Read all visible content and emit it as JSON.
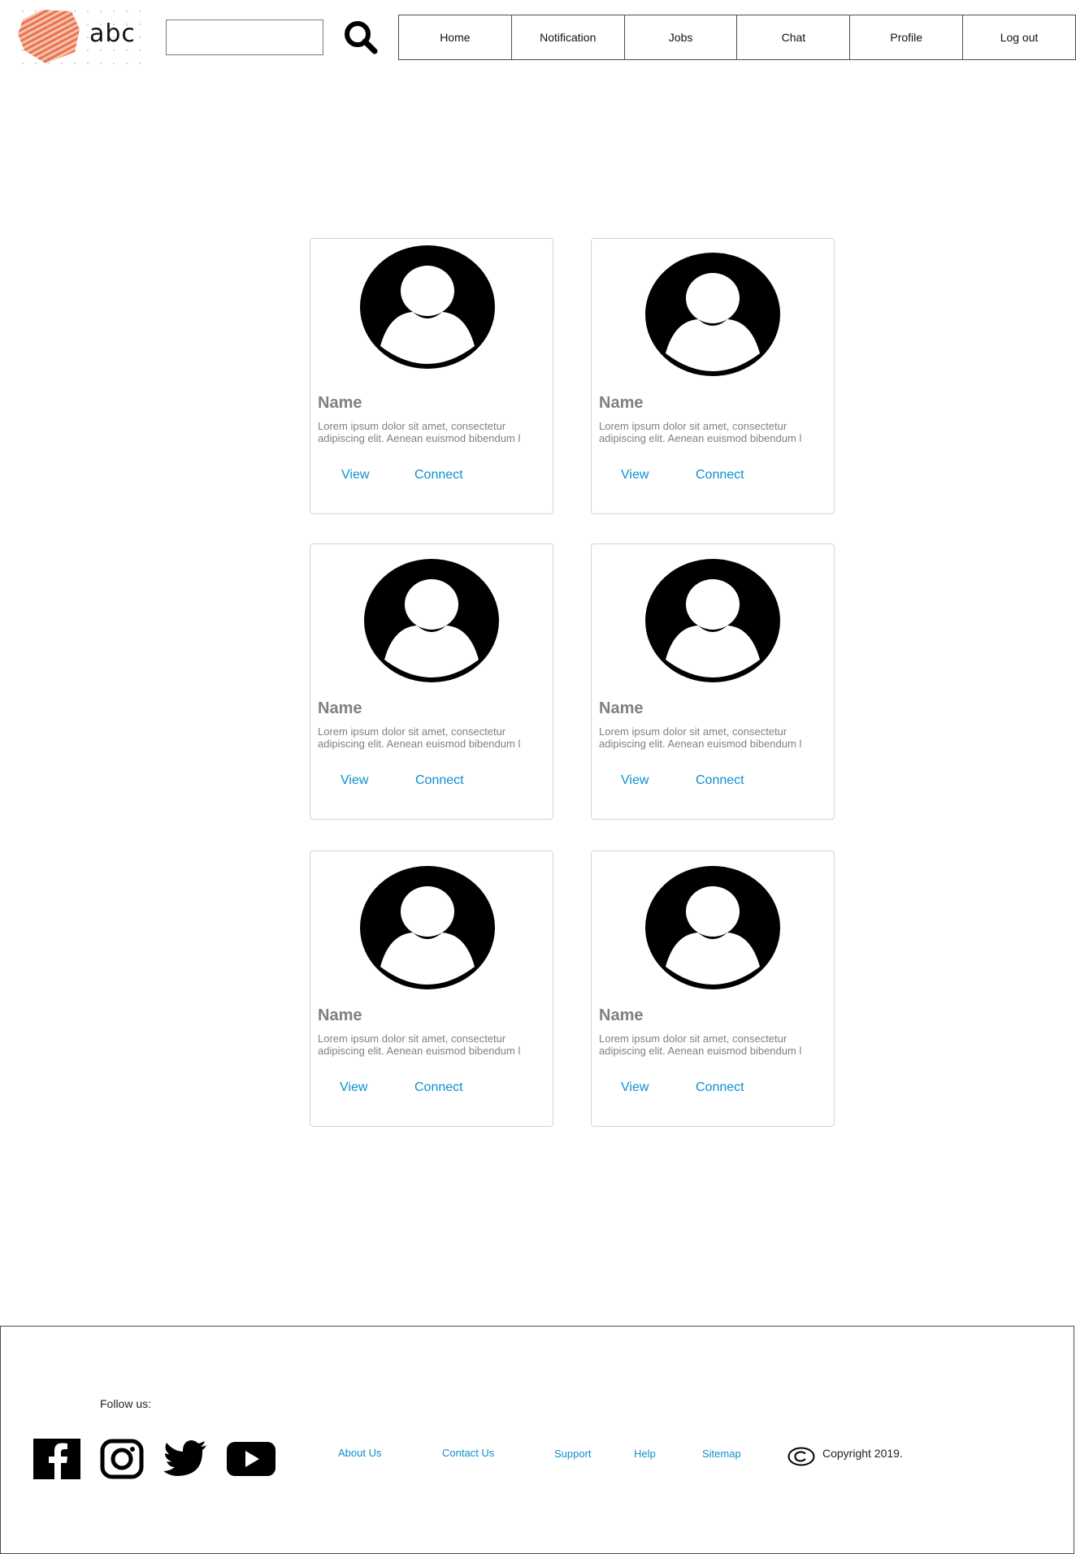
{
  "header": {
    "logo_text": "abc",
    "brand_color": "#e8744f",
    "search": {
      "value": "",
      "placeholder": ""
    },
    "search_icon": "search-icon",
    "nav": [
      {
        "id": "home",
        "label": "Home"
      },
      {
        "id": "notification",
        "label": "Notification"
      },
      {
        "id": "jobs",
        "label": "Jobs"
      },
      {
        "id": "chat",
        "label": "Chat"
      },
      {
        "id": "profile",
        "label": "Profile"
      },
      {
        "id": "logout",
        "label": "Log out"
      }
    ]
  },
  "cards": [
    {
      "name": "Name",
      "description": "Lorem ipsum dolor sit amet, consectetur adipiscing elit. Aenean euismod bibendum l",
      "view_label": "View",
      "connect_label": "Connect",
      "avatar_icon": "user-avatar-icon"
    },
    {
      "name": "Name",
      "description": "Lorem ipsum dolor sit amet, consectetur adipiscing elit. Aenean euismod bibendum l",
      "view_label": "View",
      "connect_label": "Connect",
      "avatar_icon": "user-avatar-icon"
    },
    {
      "name": "Name",
      "description": "Lorem ipsum dolor sit amet, consectetur adipiscing elit. Aenean euismod bibendum l",
      "view_label": "View",
      "connect_label": "Connect",
      "avatar_icon": "user-avatar-icon"
    },
    {
      "name": "Name",
      "description": "Lorem ipsum dolor sit amet, consectetur adipiscing elit. Aenean euismod bibendum l",
      "view_label": "View",
      "connect_label": "Connect",
      "avatar_icon": "user-avatar-icon"
    },
    {
      "name": "Name",
      "description": "Lorem ipsum dolor sit amet, consectetur adipiscing elit. Aenean euismod bibendum l",
      "view_label": "View",
      "connect_label": "Connect",
      "avatar_icon": "user-avatar-icon"
    },
    {
      "name": "Name",
      "description": "Lorem ipsum dolor sit amet, consectetur adipiscing elit. Aenean euismod bibendum l",
      "view_label": "View",
      "connect_label": "Connect",
      "avatar_icon": "user-avatar-icon"
    }
  ],
  "footer": {
    "follow_label": "Follow us:",
    "social": [
      {
        "name": "Facebook",
        "icon": "facebook-icon"
      },
      {
        "name": "Instagram",
        "icon": "instagram-icon"
      },
      {
        "name": "Twitter",
        "icon": "twitter-icon"
      },
      {
        "name": "YouTube",
        "icon": "youtube-icon"
      }
    ],
    "links": [
      "About Us",
      "Contact Us",
      "Support",
      "Help",
      "Sitemap"
    ],
    "copyright_icon": "copyright-icon",
    "copyright_text": "Copyright 2019."
  },
  "colors": {
    "link": "#0d8fd0",
    "muted_text": "#808080",
    "card_border": "#d4d4d4"
  }
}
